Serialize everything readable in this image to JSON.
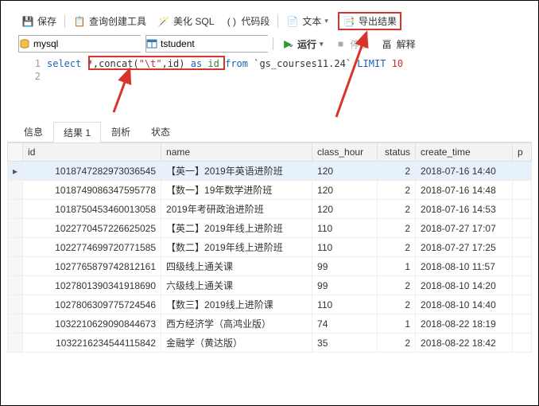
{
  "toolbar1": {
    "save": "保存",
    "query_tool": "查询创建工具",
    "beautify": "美化 SQL",
    "code_snip": "代码段",
    "text": "文本",
    "export": "导出结果"
  },
  "toolbar2": {
    "db": "mysql",
    "schema": "tstudent",
    "run": "运行",
    "stop": "停止",
    "explain": "解释"
  },
  "sql": {
    "line1_no": "1",
    "line2_no": "2",
    "kw_select": "select",
    "star": "*",
    "comma": ",",
    "concat": "concat",
    "lp": "(",
    "tab_str": "\"\\t\"",
    "comma2": ",",
    "id_field": "id",
    "rp": ")",
    "kw_as": "as",
    "alias": "id",
    "kw_from": "from",
    "backtick_table": "`gs_courses11.24`",
    "kw_limit": "LIMIT",
    "limit_n": "10"
  },
  "tabs": {
    "info": "信息",
    "result": "结果 1",
    "profile": "剖析",
    "status": "状态"
  },
  "columns": {
    "id": "id",
    "name": "name",
    "class_hour": "class_hour",
    "status": "status",
    "create_time": "create_time",
    "p": "p"
  },
  "rows": [
    {
      "sel": true,
      "id": "1018747282973036545",
      "name": "【英一】2019年英语进阶班",
      "class_hour": "120",
      "status": "2",
      "create_time": "2018-07-16 14:40"
    },
    {
      "id": "1018749086347595778",
      "name": "【数一】19年数学进阶班",
      "class_hour": "120",
      "status": "2",
      "create_time": "2018-07-16 14:48"
    },
    {
      "id": "1018750453460013058",
      "name": "2019年考研政治进阶班",
      "class_hour": "120",
      "status": "2",
      "create_time": "2018-07-16 14:53"
    },
    {
      "id": "1022770457226625025",
      "name": "【英二】2019年线上进阶班",
      "class_hour": "110",
      "status": "2",
      "create_time": "2018-07-27 17:07"
    },
    {
      "id": "1022774699720771585",
      "name": "【数二】2019年线上进阶班",
      "class_hour": "110",
      "status": "2",
      "create_time": "2018-07-27 17:25"
    },
    {
      "id": "1027765879742812161",
      "name": "四级线上通关课",
      "class_hour": "99",
      "status": "1",
      "create_time": "2018-08-10 11:57"
    },
    {
      "id": "1027801390341918690",
      "name": "六级线上通关课",
      "class_hour": "99",
      "status": "2",
      "create_time": "2018-08-10 14:20"
    },
    {
      "id": "1027806309775724546",
      "name": "【数三】2019线上进阶课",
      "class_hour": "110",
      "status": "2",
      "create_time": "2018-08-10 14:40"
    },
    {
      "id": "1032210629090844673",
      "name": "西方经济学（高鸿业版）",
      "class_hour": "74",
      "status": "1",
      "create_time": "2018-08-22 18:19"
    },
    {
      "id": "1032216234544115842",
      "name": "金融学（黄达版）",
      "class_hour": "35",
      "status": "2",
      "create_time": "2018-08-22 18:42"
    }
  ]
}
